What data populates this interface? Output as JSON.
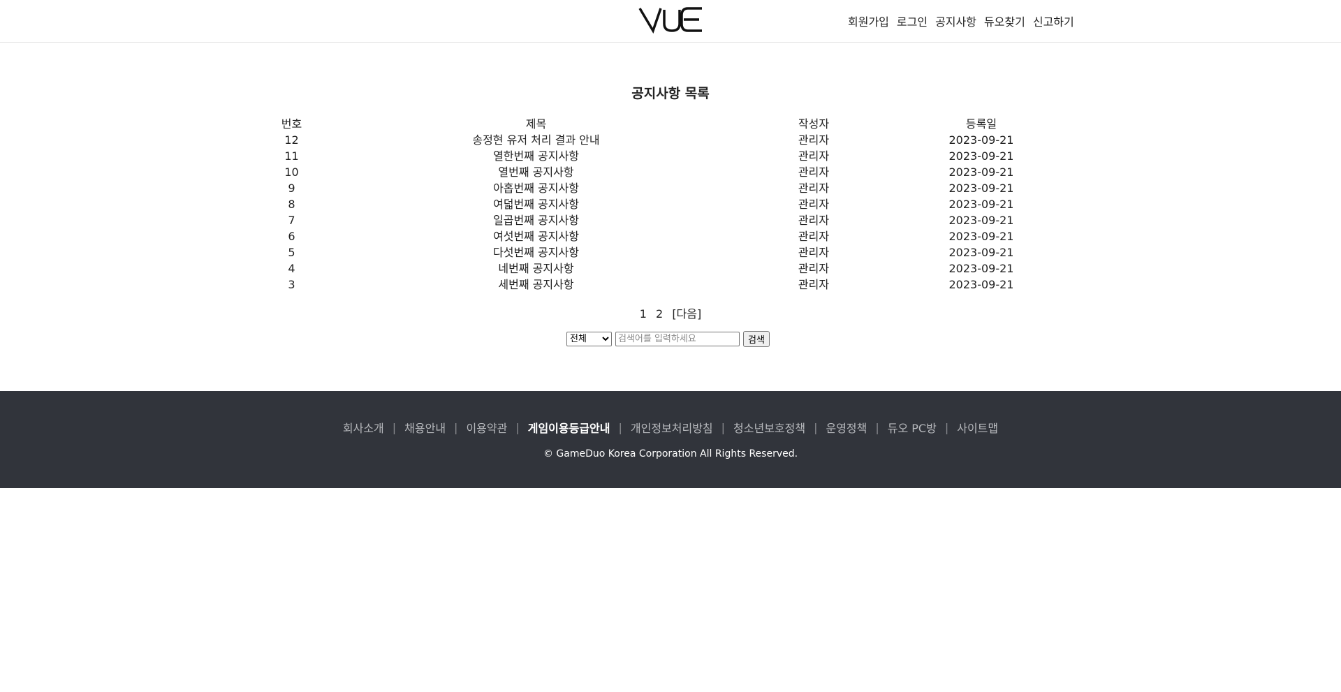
{
  "header": {
    "logo_text": "VUE",
    "nav": [
      "회원가입",
      "로그인",
      "공지사항",
      "듀오찾기",
      "신고하기"
    ]
  },
  "page": {
    "title": "공지사항 목록"
  },
  "table": {
    "headers": [
      "번호",
      "제목",
      "작성자",
      "등록일"
    ],
    "rows": [
      [
        "12",
        "송정현 유저 처리 결과 안내",
        "관리자",
        "2023-09-21"
      ],
      [
        "11",
        "열한번째 공지사항",
        "관리자",
        "2023-09-21"
      ],
      [
        "10",
        "열번째 공지사항",
        "관리자",
        "2023-09-21"
      ],
      [
        "9",
        "아홉번째 공지사항",
        "관리자",
        "2023-09-21"
      ],
      [
        "8",
        "여덟번째 공지사항",
        "관리자",
        "2023-09-21"
      ],
      [
        "7",
        "일곱번째 공지사항",
        "관리자",
        "2023-09-21"
      ],
      [
        "6",
        "여섯번째 공지사항",
        "관리자",
        "2023-09-21"
      ],
      [
        "5",
        "다섯번째 공지사항",
        "관리자",
        "2023-09-21"
      ],
      [
        "4",
        "네번째 공지사항",
        "관리자",
        "2023-09-21"
      ],
      [
        "3",
        "세번째 공지사항",
        "관리자",
        "2023-09-21"
      ]
    ]
  },
  "pagination": {
    "pages": [
      "1",
      "2"
    ],
    "next_label": "[다음]"
  },
  "search": {
    "select_value": "전체",
    "placeholder": "검색어를 입력하세요",
    "button_label": "검색"
  },
  "footer": {
    "links": [
      "회사소개",
      "채용안내",
      "이용약관",
      "게임이용등급안내",
      "개인정보처리방침",
      "청소년보호정책",
      "운영정책",
      "듀오 PC방",
      "사이트맵"
    ],
    "highlighted_link": "게임이용등급안내",
    "copyright": "© GameDuo Korea Corporation All Rights Reserved."
  },
  "colors": {
    "footer_bg": "#31343b",
    "footer_text": "#b6b8bc"
  }
}
